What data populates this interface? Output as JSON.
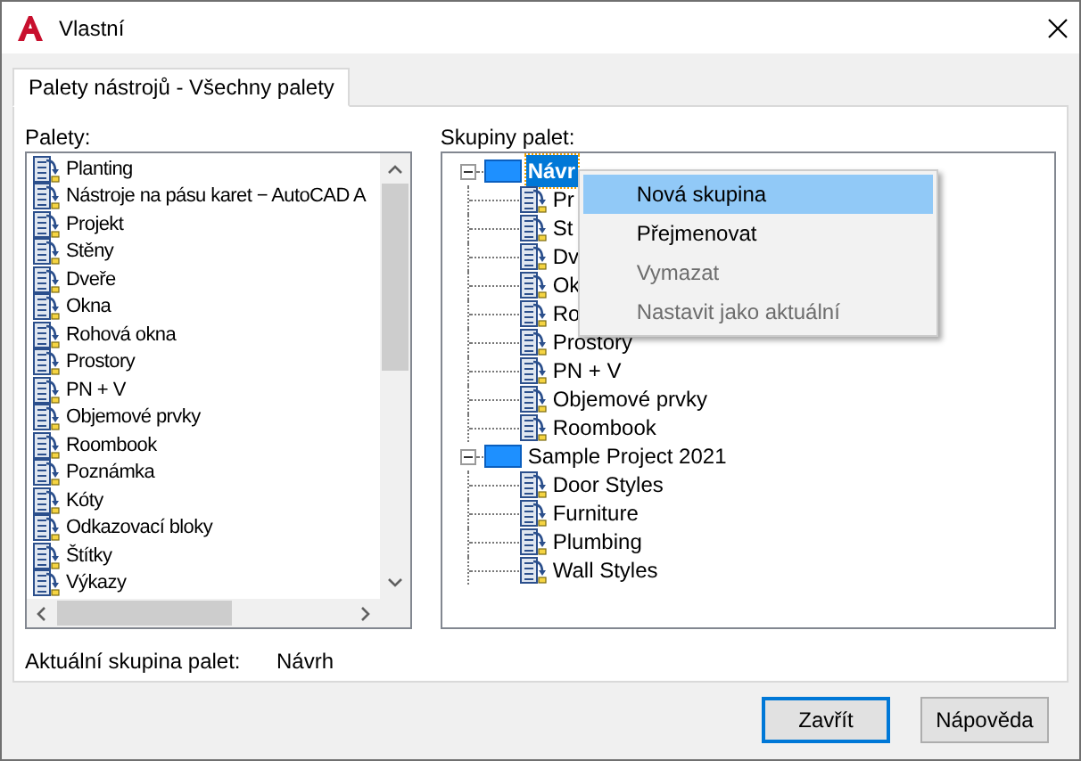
{
  "window": {
    "title": "Vlastní"
  },
  "tabs": [
    {
      "label": "Palety nástrojů - Všechny palety",
      "selected": true
    }
  ],
  "palettes": {
    "label": "Palety:",
    "items": [
      {
        "label": "Planting"
      },
      {
        "label": "Nástroje na pásu karet − AutoCAD A"
      },
      {
        "label": "Projekt"
      },
      {
        "label": "Stěny"
      },
      {
        "label": "Dveře"
      },
      {
        "label": "Okna"
      },
      {
        "label": "Rohová okna"
      },
      {
        "label": "Prostory"
      },
      {
        "label": "PN + V"
      },
      {
        "label": "Objemové prvky"
      },
      {
        "label": "Roombook"
      },
      {
        "label": "Poznámka"
      },
      {
        "label": "Kóty"
      },
      {
        "label": "Odkazovací bloky"
      },
      {
        "label": "Štítky"
      },
      {
        "label": "Výkazy"
      }
    ]
  },
  "groups": {
    "label": "Skupiny palet:",
    "tree": [
      {
        "label": "Návr",
        "selected": true,
        "expanded": true,
        "children": [
          {
            "label": "Pr"
          },
          {
            "label": "St"
          },
          {
            "label": "Dv"
          },
          {
            "label": "Ok"
          },
          {
            "label": "Ro"
          },
          {
            "label": "Prostory"
          },
          {
            "label": "PN + V"
          },
          {
            "label": "Objemové prvky"
          },
          {
            "label": "Roombook"
          }
        ]
      },
      {
        "label": "Sample Project 2021",
        "selected": false,
        "expanded": true,
        "children": [
          {
            "label": "Door Styles"
          },
          {
            "label": "Furniture"
          },
          {
            "label": "Plumbing"
          },
          {
            "label": "Wall Styles"
          }
        ]
      }
    ]
  },
  "context_menu": [
    {
      "label": "Nová skupina",
      "highlighted": true,
      "disabled": false
    },
    {
      "label": "Přejmenovat",
      "highlighted": false,
      "disabled": false
    },
    {
      "label": "Vymazat",
      "highlighted": false,
      "disabled": true
    },
    {
      "label": "Nastavit jako aktuální",
      "highlighted": false,
      "disabled": true
    }
  ],
  "current_group": {
    "label": "Aktuální skupina palet:",
    "value": "Návrh"
  },
  "buttons": [
    {
      "label": "Zavřít",
      "default": true
    },
    {
      "label": "Nápověda",
      "default": false
    }
  ]
}
